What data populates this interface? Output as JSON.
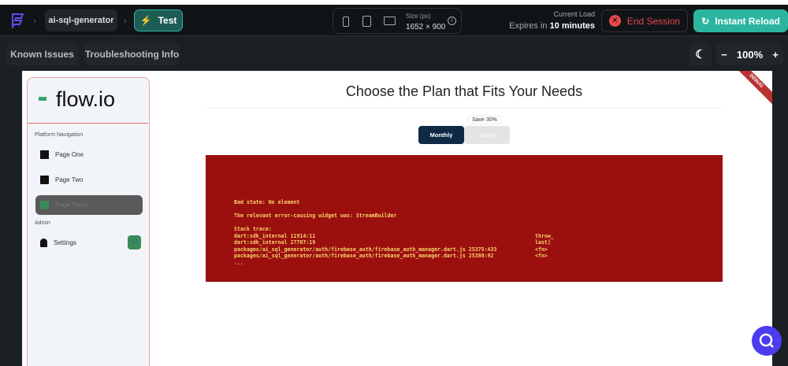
{
  "topbar": {
    "project": "ai-sql-generator",
    "mode": "Test",
    "size_label": "Size (px)",
    "size_value": "1652 × 900",
    "load_label": "Current Load",
    "expires_prefix": "Expires in",
    "expires_value": "10 minutes",
    "end_session": "End Session",
    "instant_reload": "Instant Reload"
  },
  "subbar": {
    "known_issues": "Known Issues",
    "troubleshooting": "Troubleshooting Info",
    "zoom": "100%",
    "zoom_out": "−",
    "zoom_in": "+"
  },
  "app": {
    "logo": "flow.io",
    "nav_section": "Platform Navigation",
    "nav": [
      "Page One",
      "Page Two",
      "Page Three"
    ],
    "admin_section": "Admin",
    "settings": "Settings",
    "settings_badge": "12",
    "title": "Choose the Plan that Fits Your Needs",
    "monthly": "Monthly",
    "yearly": "Yearly",
    "save_badge": "Save 30%",
    "debug": "DEBUG"
  },
  "error": {
    "line1": "Bad state: No element",
    "line2": "The relevant error-causing widget was: StreamBuilder",
    "stack_title": "Stack trace:",
    "rows": [
      {
        "loc": "dart:sdk_internal 11914:11",
        "fn": "throw_"
      },
      {
        "loc": "dart:sdk_internal 27707:19",
        "fn": "last]"
      },
      {
        "loc": "packages/ai_sql_generator/auth/firebase_auth/firebase_auth_manager.dart.js 25375:433",
        "fn": "<fn>"
      },
      {
        "loc": "packages/ai_sql_generator/auth/firebase_auth/firebase_auth_manager.dart.js 25380:92",
        "fn": "<fn>"
      }
    ],
    "ellipsis": "..."
  },
  "colors": {
    "accent": "#2bb5a0",
    "danger": "#e5484d",
    "error_bg": "#9c0f0f",
    "error_text": "#f7d46a"
  }
}
